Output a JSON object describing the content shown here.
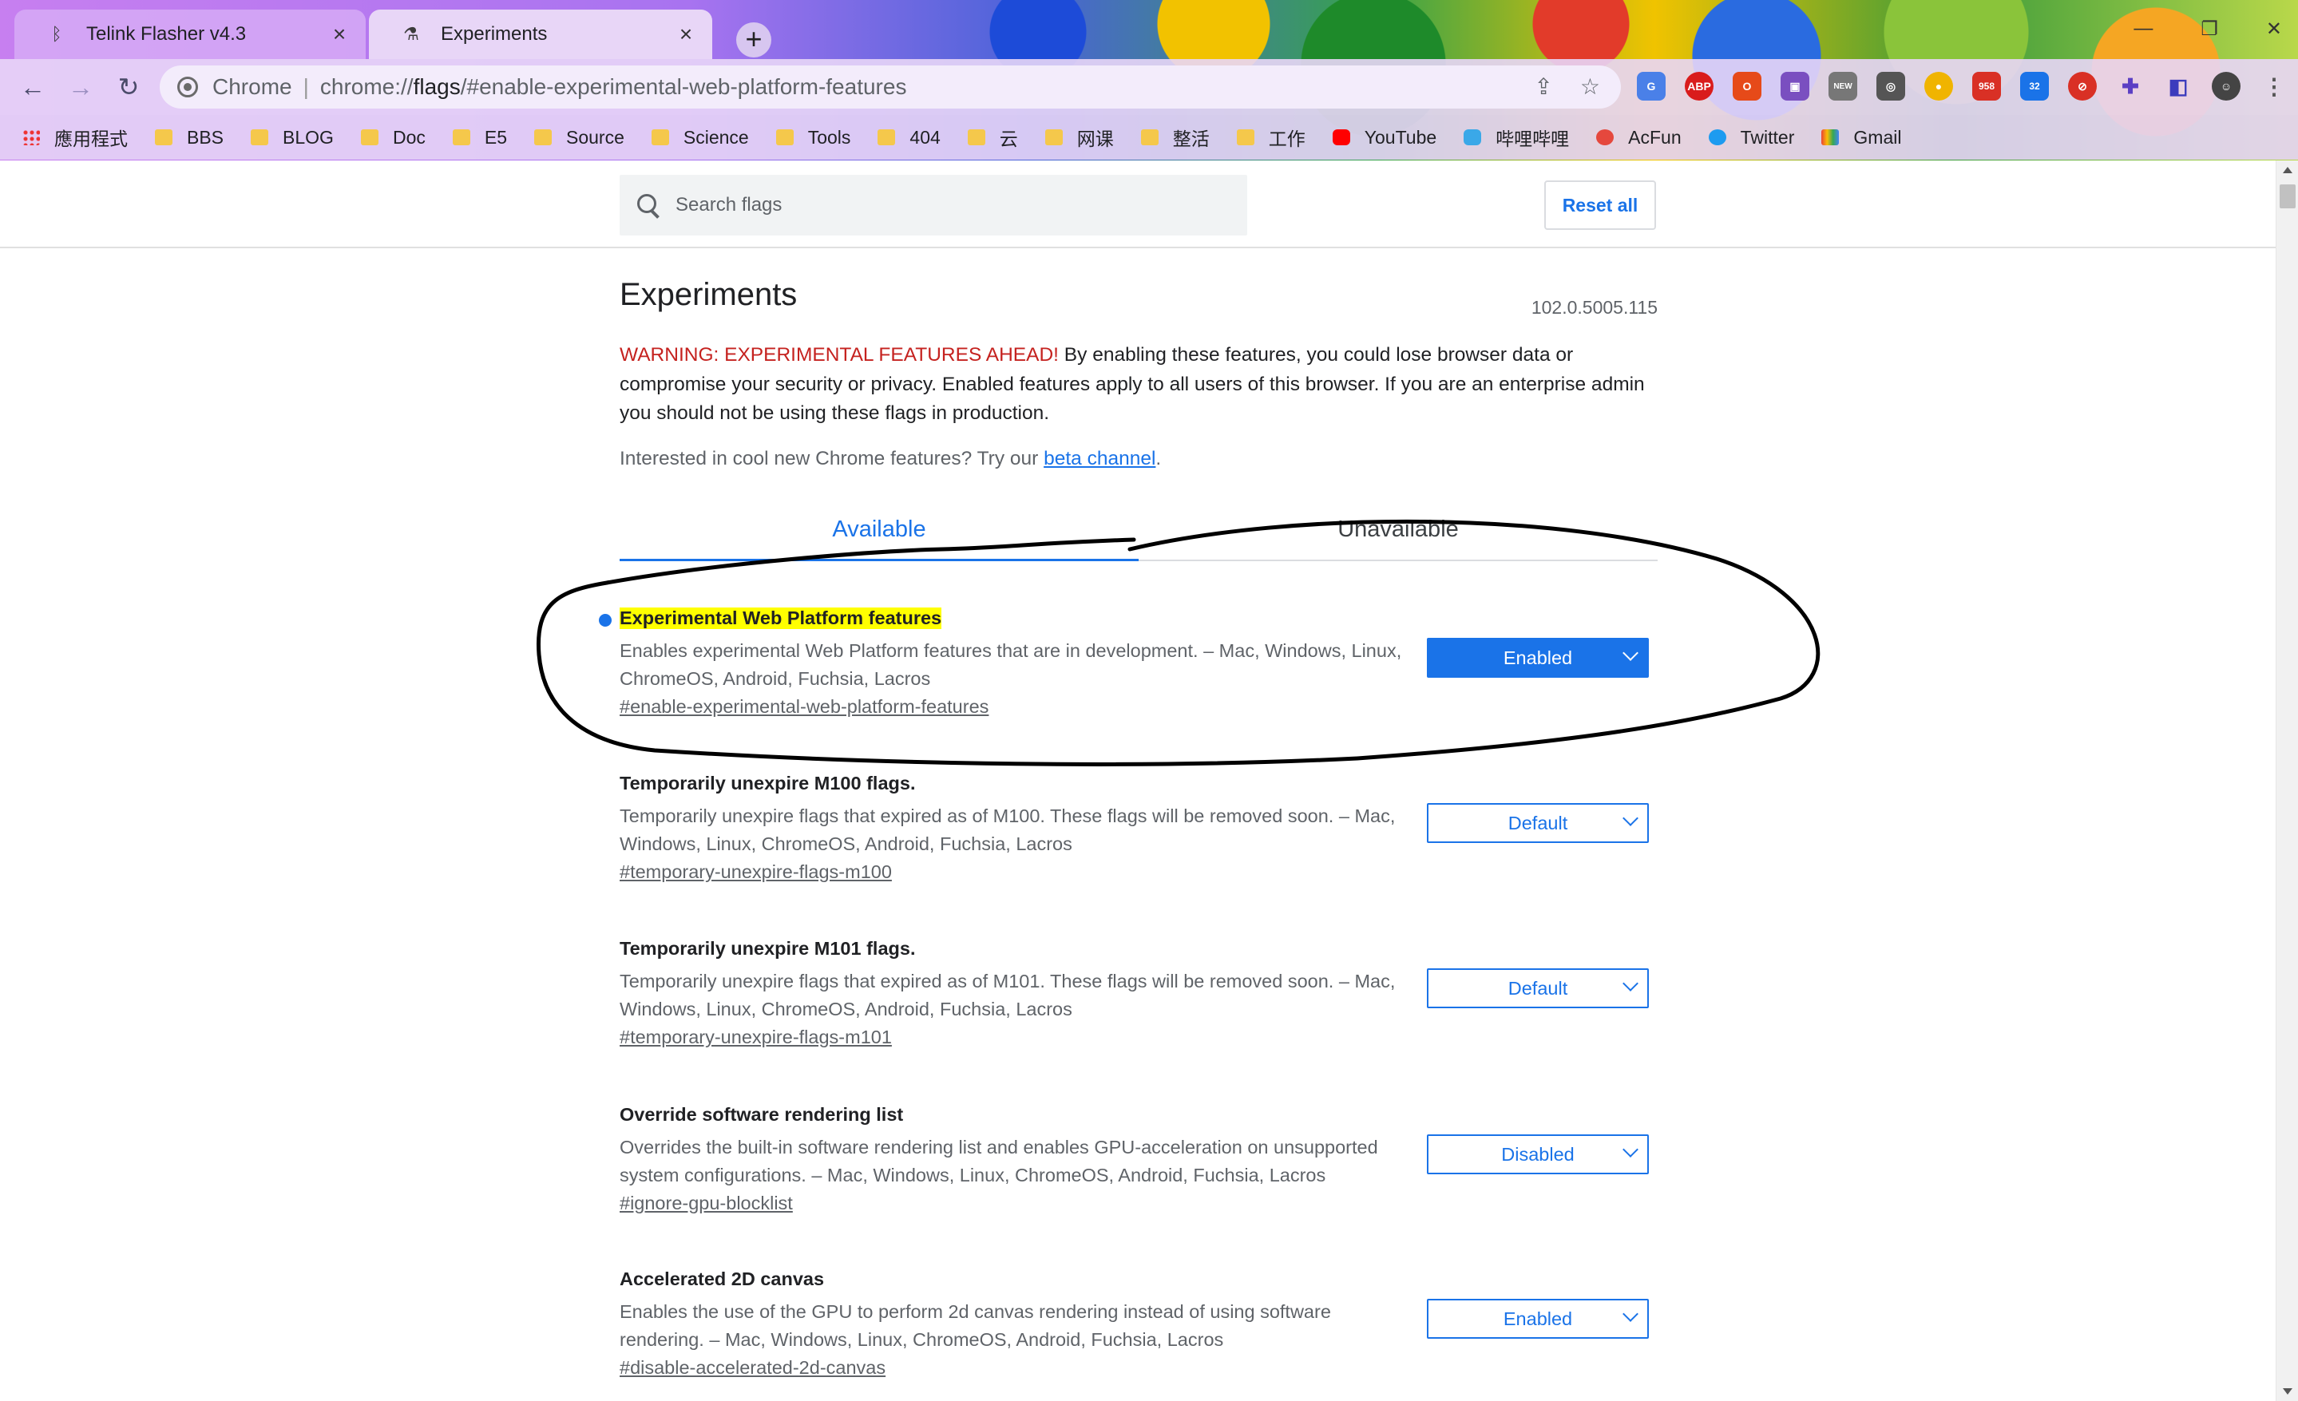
{
  "browser": {
    "tabs": [
      {
        "title": "Telink Flasher v4.3",
        "icon": "bluetooth-icon",
        "active": false
      },
      {
        "title": "Experiments",
        "icon": "flask-icon",
        "active": true
      }
    ],
    "omnibox": {
      "site": "Chrome",
      "url_host": "chrome://",
      "url_bold": "flags",
      "url_rest": "/#enable-experimental-web-platform-features"
    },
    "extensions": [
      "ABP",
      "NEW",
      "958",
      "32"
    ],
    "bookmarks": [
      {
        "label": "應用程式",
        "icon": "apps-icon"
      },
      {
        "label": "BBS",
        "icon": "folder-icon"
      },
      {
        "label": "BLOG",
        "icon": "folder-icon"
      },
      {
        "label": "Doc",
        "icon": "folder-icon"
      },
      {
        "label": "E5",
        "icon": "folder-icon"
      },
      {
        "label": "Source",
        "icon": "folder-icon"
      },
      {
        "label": "Science",
        "icon": "folder-icon"
      },
      {
        "label": "Tools",
        "icon": "folder-icon"
      },
      {
        "label": "404",
        "icon": "folder-icon"
      },
      {
        "label": "云",
        "icon": "folder-icon"
      },
      {
        "label": "网课",
        "icon": "folder-icon"
      },
      {
        "label": "整活",
        "icon": "folder-icon"
      },
      {
        "label": "工作",
        "icon": "folder-icon"
      },
      {
        "label": "YouTube",
        "icon": "youtube-icon"
      },
      {
        "label": "哔哩哔哩",
        "icon": "bilibili-icon"
      },
      {
        "label": "AcFun",
        "icon": "acfun-icon"
      },
      {
        "label": "Twitter",
        "icon": "twitter-icon"
      },
      {
        "label": "Gmail",
        "icon": "gmail-icon"
      }
    ]
  },
  "header": {
    "search_placeholder": "Search flags",
    "reset_label": "Reset all"
  },
  "main": {
    "title": "Experiments",
    "version": "102.0.5005.115",
    "warning_red": "WARNING: EXPERIMENTAL FEATURES AHEAD!",
    "warning_text": " By enabling these features, you could lose browser data or compromise your security or privacy. Enabled features apply to all users of this browser. If you are an enterprise admin you should not be using these flags in production.",
    "interested_text": "Interested in cool new Chrome features? Try our ",
    "beta_link": "beta channel",
    "interested_end": ".",
    "tabs": [
      "Available",
      "Unavailable"
    ]
  },
  "flags": [
    {
      "title": "Experimental Web Platform features",
      "description": "Enables experimental Web Platform features that are in development. – Mac, Windows, Linux, ChromeOS, Android, Fuchsia, Lacros",
      "link": "#enable-experimental-web-platform-features",
      "value": "Enabled",
      "modified": true
    },
    {
      "title": "Temporarily unexpire M100 flags.",
      "description": "Temporarily unexpire flags that expired as of M100. These flags will be removed soon. – Mac, Windows, Linux, ChromeOS, Android, Fuchsia, Lacros",
      "link": "#temporary-unexpire-flags-m100",
      "value": "Default",
      "modified": false
    },
    {
      "title": "Temporarily unexpire M101 flags.",
      "description": "Temporarily unexpire flags that expired as of M101. These flags will be removed soon. – Mac, Windows, Linux, ChromeOS, Android, Fuchsia, Lacros",
      "link": "#temporary-unexpire-flags-m101",
      "value": "Default",
      "modified": false
    },
    {
      "title": "Override software rendering list",
      "description": "Overrides the built-in software rendering list and enables GPU-acceleration on unsupported system configurations. – Mac, Windows, Linux, ChromeOS, Android, Fuchsia, Lacros",
      "link": "#ignore-gpu-blocklist",
      "value": "Disabled",
      "modified": false
    },
    {
      "title": "Accelerated 2D canvas",
      "description": "Enables the use of the GPU to perform 2d canvas rendering instead of using software rendering. – Mac, Windows, Linux, ChromeOS, Android, Fuchsia, Lacros",
      "link": "#disable-accelerated-2d-canvas",
      "value": "Enabled",
      "modified": false
    }
  ],
  "colors": {
    "accent": "#1a73e8",
    "warning": "#c5221f",
    "highlight": "#ffff00",
    "annotation": "#000000"
  }
}
